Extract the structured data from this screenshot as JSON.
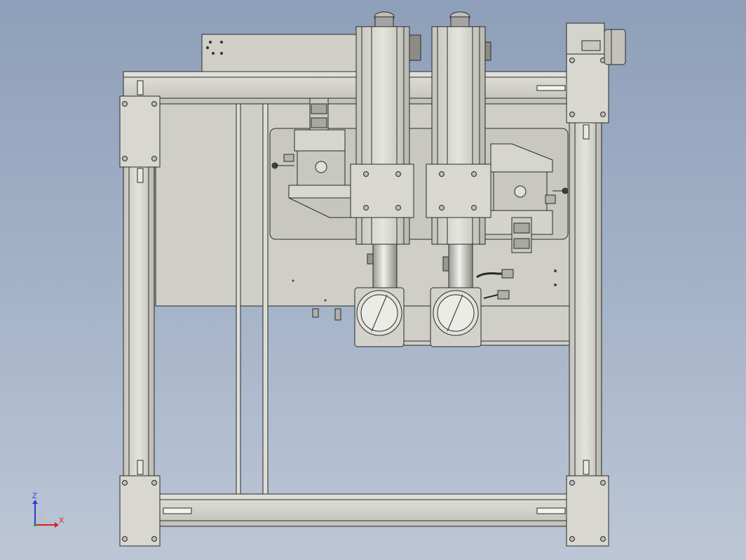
{
  "viewport": {
    "background_top": "#8e9fb9",
    "background_bottom": "#bcc6d6",
    "part_fill": "#d4d4cd",
    "part_shade": "#bdbdb5",
    "edge_color": "#2a2a2a"
  },
  "triad": {
    "z_label": "Z",
    "x_label": "X",
    "z_color": "#2a3cd8",
    "x_color": "#d82020",
    "y_color": "#20a020"
  }
}
